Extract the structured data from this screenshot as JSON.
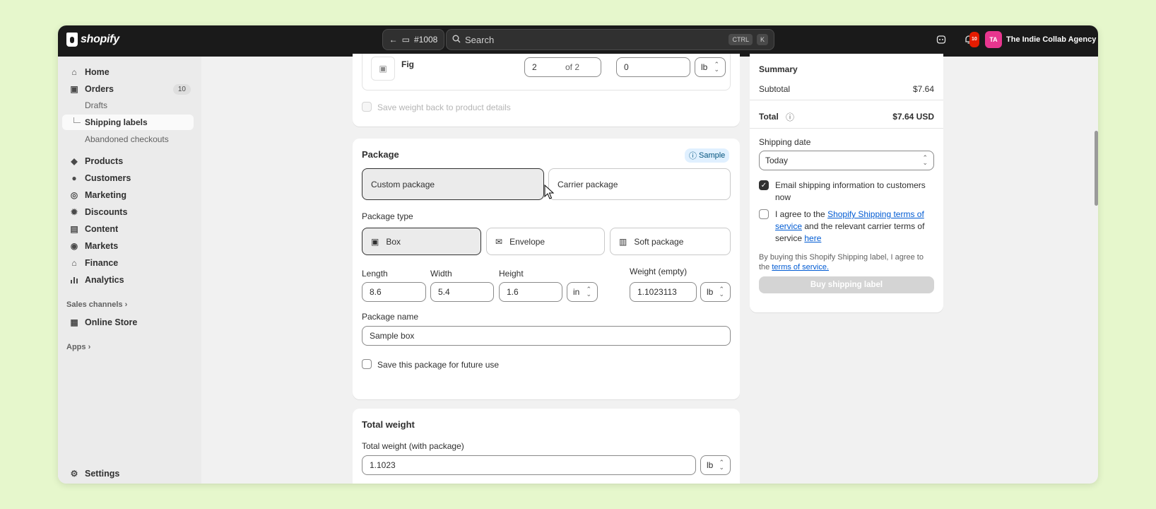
{
  "topbar": {
    "logo_text": "shopify",
    "order_label": "#1008",
    "search_placeholder": "Search",
    "kbd1": "CTRL",
    "kbd2": "K",
    "notif_count": "10",
    "avatar_initials": "TA",
    "store_name": "The Indie Collab Agency"
  },
  "sidebar": {
    "home": "Home",
    "orders": "Orders",
    "orders_count": "10",
    "drafts": "Drafts",
    "shipping_labels": "Shipping labels",
    "abandoned": "Abandoned checkouts",
    "products": "Products",
    "customers": "Customers",
    "marketing": "Marketing",
    "discounts": "Discounts",
    "content": "Content",
    "markets": "Markets",
    "finance": "Finance",
    "analytics": "Analytics",
    "sales_channels": "Sales channels",
    "online_store": "Online Store",
    "apps": "Apps",
    "settings": "Settings"
  },
  "item": {
    "name": "Fig",
    "qty": "2",
    "qty_of": "of 2",
    "weight": "0",
    "unit": "lb",
    "save_weight_label": "Save weight back to product details"
  },
  "package": {
    "title": "Package",
    "badge": "Sample",
    "custom_label": "Custom package",
    "carrier_label": "Carrier package",
    "type_label": "Package type",
    "box": "Box",
    "envelope": "Envelope",
    "soft": "Soft package",
    "length_label": "Length",
    "width_label": "Width",
    "height_label": "Height",
    "weight_empty_label": "Weight (empty)",
    "length": "8.6",
    "width": "5.4",
    "height": "1.6",
    "dim_unit": "in",
    "weight_empty": "1.1023113",
    "weight_unit": "lb",
    "name_label": "Package name",
    "name_value": "Sample box",
    "save_future": "Save this package for future use"
  },
  "total_weight": {
    "title": "Total weight",
    "label": "Total weight (with package)",
    "value": "1.1023",
    "unit": "lb"
  },
  "summary": {
    "title": "Summary",
    "subtotal_label": "Subtotal",
    "subtotal": "$7.64",
    "total_label": "Total",
    "total": "$7.64 USD",
    "ship_date_label": "Shipping date",
    "ship_date": "Today",
    "email_label_1": "Email shipping information to customers",
    "email_label_2": "now",
    "agree_1": "I agree to the ",
    "agree_link1": "Shopify Shipping terms of",
    "agree_link2": "service",
    "agree_2": " and the relevant carrier terms of",
    "agree_3": "service ",
    "agree_link3": "here",
    "buying_1": "By buying this Shopify Shipping label, I agree to",
    "buying_2": "the ",
    "buying_link": "terms of service.",
    "buy_button": "Buy shipping label"
  }
}
